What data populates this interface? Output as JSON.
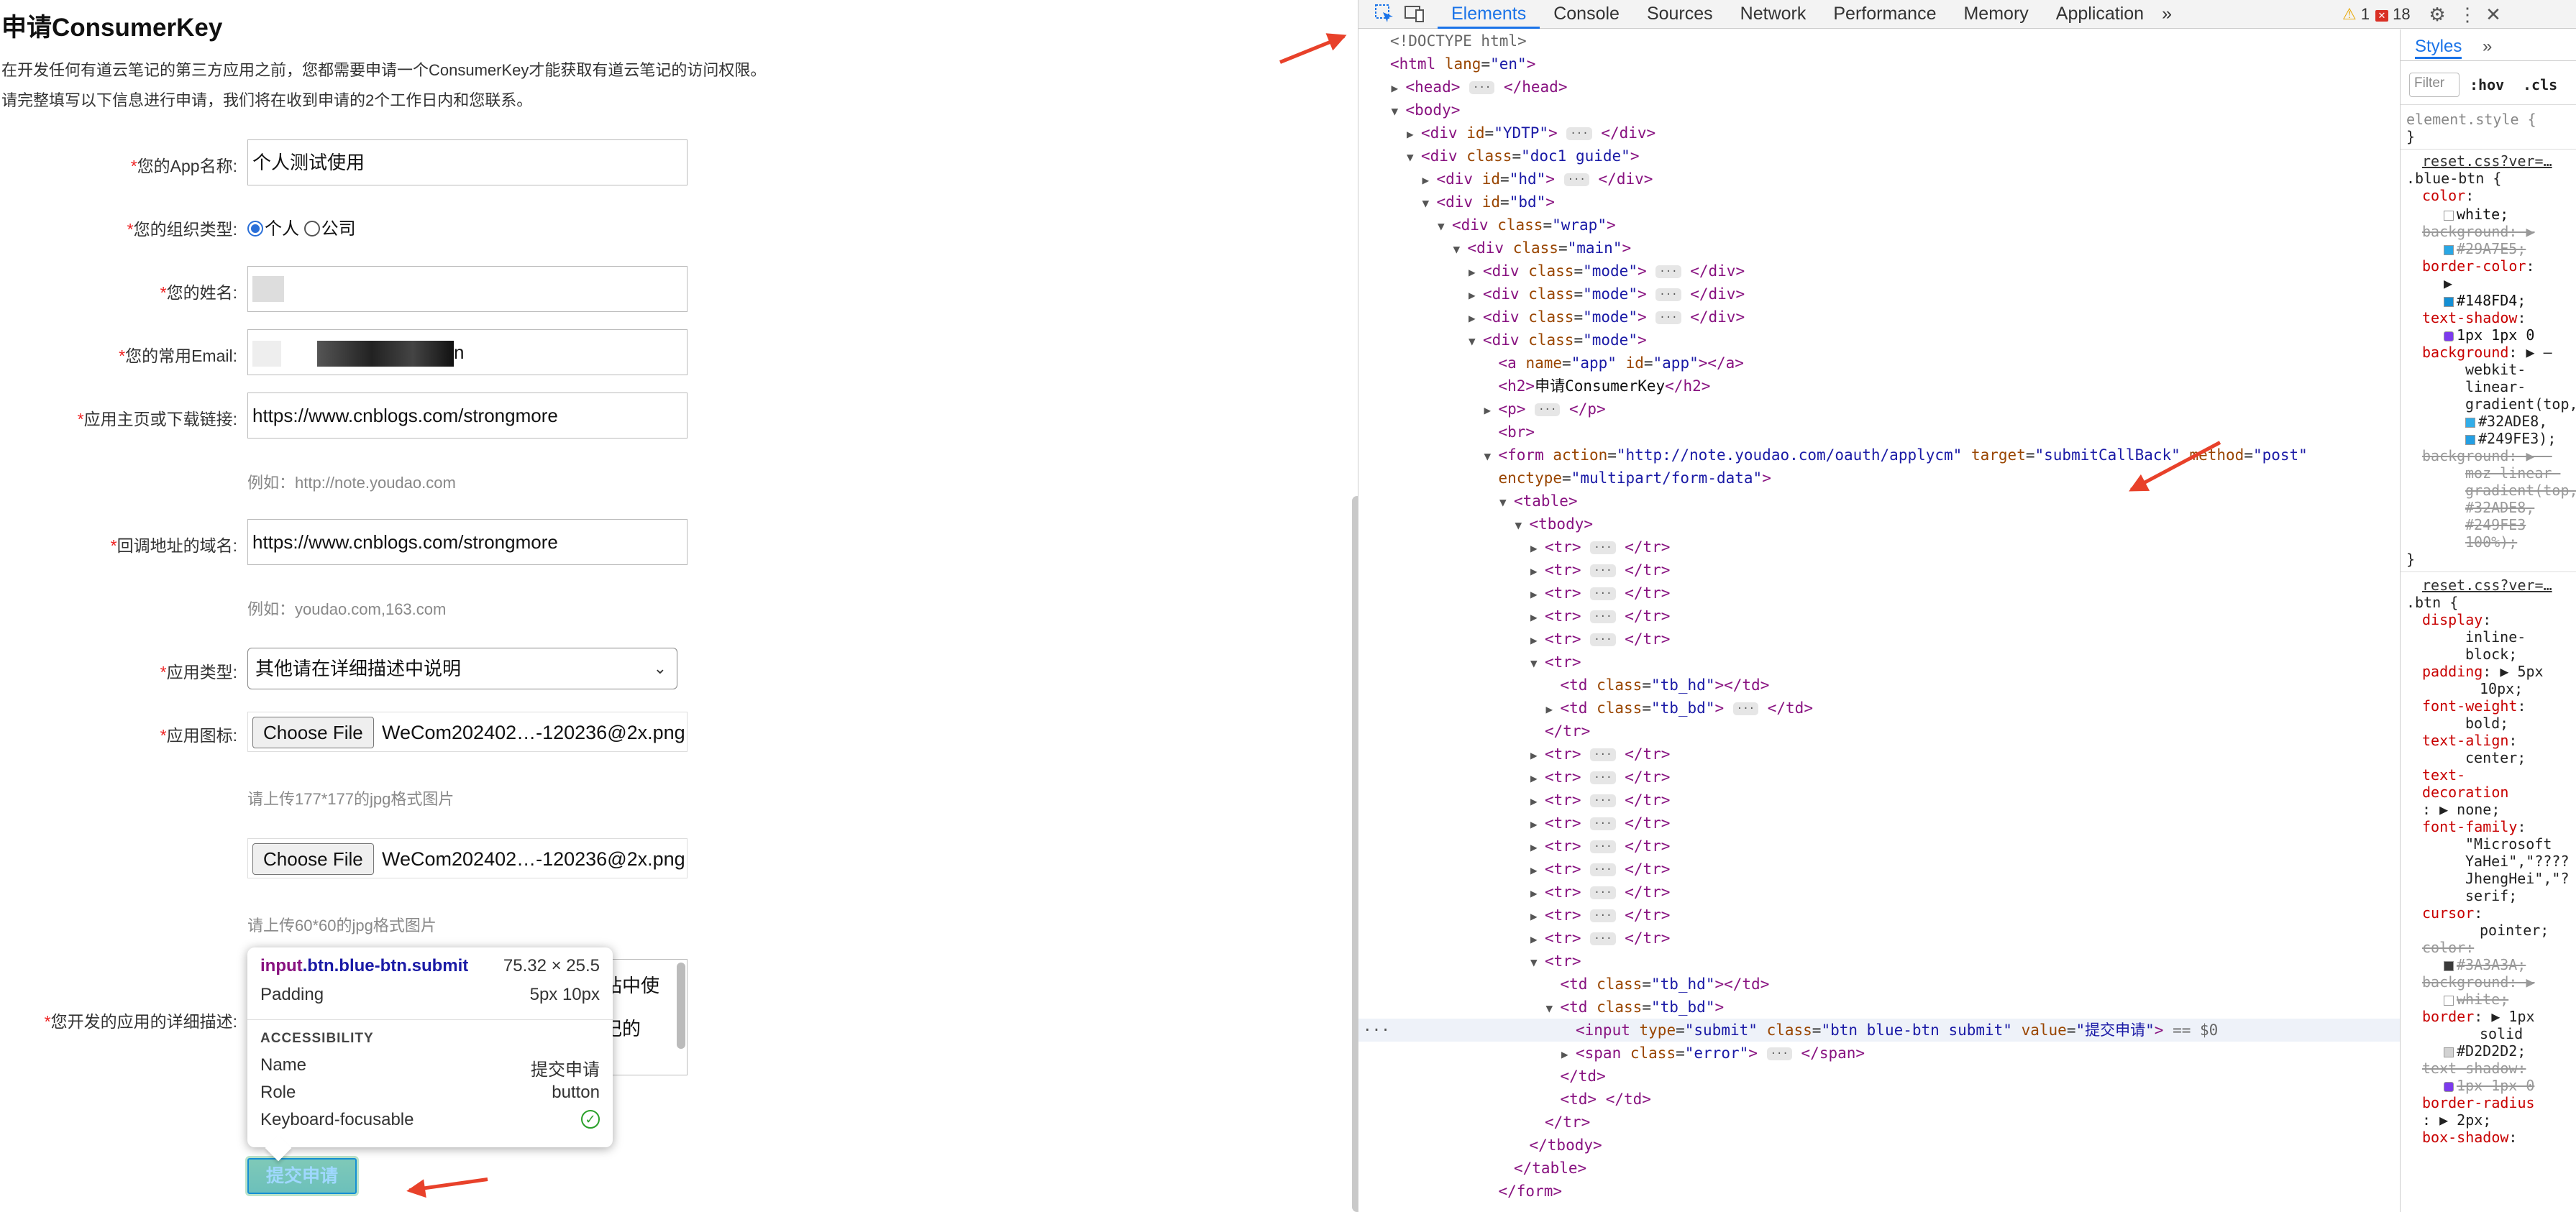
{
  "page": {
    "title": "申请ConsumerKey",
    "intro1": "在开发任何有道云笔记的第三方应用之前，您都需要申请一个ConsumerKey才能获取有道云笔记的访问权限。",
    "intro2": "请完整填写以下信息进行申请，我们将在收到申请的2个工作日内和您联系。"
  },
  "form": {
    "app_name_label": "您的App名称:",
    "app_name_value": "个人测试使用",
    "org_type_label": "您的组织类型:",
    "org_personal": "个人",
    "org_company": "公司",
    "name_label": "您的姓名:",
    "email_label": "您的常用Email:",
    "email_tail": "n",
    "homepage_label": "应用主页或下载链接:",
    "homepage_value": "https://www.cnblogs.com/strongmore",
    "homepage_hint": "例如：http://note.youdao.com",
    "callback_label": "回调地址的域名:",
    "callback_value": "https://www.cnblogs.com/strongmore",
    "callback_hint": "例如：youdao.com,163.com",
    "apptype_label": "应用类型:",
    "apptype_value": "其他请在详细描述中说明",
    "icon_label": "应用图标:",
    "choose_file": "Choose File",
    "file1": "WeCom202402…-120236@2x.png",
    "hint1": "请上传177*177的jpg格式图片",
    "file2": "WeCom202402…-120236@2x.png",
    "hint2": "请上传60*60的jpg格式图片",
    "desc_label": "您开发的应用的详细描述:",
    "desc_line1": "站中使",
    "desc_line2": "记的",
    "submit": "提交申请"
  },
  "tooltip": {
    "selector_tag": "input",
    "selector_class": ".btn.blue-btn.submit",
    "size": "75.32 × 25.5",
    "padding_label": "Padding",
    "padding_value": "5px 10px",
    "accessibility": "ACCESSIBILITY",
    "name_label": "Name",
    "name_value": "提交申请",
    "role_label": "Role",
    "role_value": "button",
    "kbd_label": "Keyboard-focusable"
  },
  "devtools": {
    "tabs": [
      "Elements",
      "Console",
      "Sources",
      "Network",
      "Performance",
      "Memory",
      "Application"
    ],
    "more_tabs": "»",
    "warnings": "1",
    "errors": "18",
    "styles_tab": "Styles",
    "styles_more": "»",
    "filter_placeholder": "Filter",
    "hov": ":hov",
    "cls": ".cls",
    "element_style": "element.style {",
    "close_brace": "}",
    "src1": "reset.css?ver=…",
    "sel1": ".blue-btn {",
    "src2": "reset.css?ver=…",
    "sel2": ".btn {",
    "dom_lines": [
      {
        "indent": 0,
        "html": "<span class='cm'>&lt;!DOCTYPE html&gt;</span>"
      },
      {
        "indent": 0,
        "html": "<span class='t'>&lt;html</span> <span class='an'>lang</span>=<span class='av'>\"en\"</span><span class='t'>&gt;</span>"
      },
      {
        "indent": 1,
        "tw": "▶",
        "html": "<span class='t'>&lt;head&gt;</span> <span class='ell'>···</span> <span class='t'>&lt;/head&gt;</span>"
      },
      {
        "indent": 1,
        "tw": "▼",
        "html": "<span class='t'>&lt;body&gt;</span>"
      },
      {
        "indent": 2,
        "tw": "▶",
        "html": "<span class='t'>&lt;div</span> <span class='an'>id</span>=<span class='av'>\"YDTP\"</span><span class='t'>&gt;</span> <span class='ell'>···</span> <span class='t'>&lt;/div&gt;</span>"
      },
      {
        "indent": 2,
        "tw": "▼",
        "html": "<span class='t'>&lt;div</span> <span class='an'>class</span>=<span class='av'>\"doc1 guide\"</span><span class='t'>&gt;</span>"
      },
      {
        "indent": 3,
        "tw": "▶",
        "html": "<span class='t'>&lt;div</span> <span class='an'>id</span>=<span class='av'>\"hd\"</span><span class='t'>&gt;</span> <span class='ell'>···</span> <span class='t'>&lt;/div&gt;</span>"
      },
      {
        "indent": 3,
        "tw": "▼",
        "html": "<span class='t'>&lt;div</span> <span class='an'>id</span>=<span class='av'>\"bd\"</span><span class='t'>&gt;</span>"
      },
      {
        "indent": 4,
        "tw": "▼",
        "html": "<span class='t'>&lt;div</span> <span class='an'>class</span>=<span class='av'>\"wrap\"</span><span class='t'>&gt;</span>"
      },
      {
        "indent": 5,
        "tw": "▼",
        "html": "<span class='t'>&lt;div</span> <span class='an'>class</span>=<span class='av'>\"main\"</span><span class='t'>&gt;</span>"
      },
      {
        "indent": 6,
        "tw": "▶",
        "html": "<span class='t'>&lt;div</span> <span class='an'>class</span>=<span class='av'>\"mode\"</span><span class='t'>&gt;</span> <span class='ell'>···</span> <span class='t'>&lt;/div&gt;</span>"
      },
      {
        "indent": 6,
        "tw": "▶",
        "html": "<span class='t'>&lt;div</span> <span class='an'>class</span>=<span class='av'>\"mode\"</span><span class='t'>&gt;</span> <span class='ell'>···</span> <span class='t'>&lt;/div&gt;</span>"
      },
      {
        "indent": 6,
        "tw": "▶",
        "html": "<span class='t'>&lt;div</span> <span class='an'>class</span>=<span class='av'>\"mode\"</span><span class='t'>&gt;</span> <span class='ell'>···</span> <span class='t'>&lt;/div&gt;</span>"
      },
      {
        "indent": 6,
        "tw": "▼",
        "html": "<span class='t'>&lt;div</span> <span class='an'>class</span>=<span class='av'>\"mode\"</span><span class='t'>&gt;</span>"
      },
      {
        "indent": 7,
        "html": "<span class='t'>&lt;a</span> <span class='an'>name</span>=<span class='av'>\"app\"</span> <span class='an'>id</span>=<span class='av'>\"app\"</span><span class='t'>&gt;&lt;/a&gt;</span>"
      },
      {
        "indent": 7,
        "html": "<span class='t'>&lt;h2&gt;</span><span class='tx'>申请ConsumerKey</span><span class='t'>&lt;/h2&gt;</span>"
      },
      {
        "indent": 7,
        "tw": "▶",
        "html": "<span class='t'>&lt;p&gt;</span> <span class='ell'>···</span> <span class='t'>&lt;/p&gt;</span>"
      },
      {
        "indent": 7,
        "html": "<span class='t'>&lt;br&gt;</span>"
      },
      {
        "indent": 7,
        "tw": "▼",
        "html": "<span class='t'>&lt;form</span> <span class='an'>action</span>=<span class='av'>\"http://note.youdao.com/oauth/applycm\"</span> <span class='an'>target</span>=<span class='av'>\"submitCallBack\"</span> <span class='an'>method</span>=<span class='av'>\"post\"</span>"
      },
      {
        "indent": 7,
        "html": "<span class='an'>enctype</span>=<span class='av'>\"multipart/form-data\"</span><span class='t'>&gt;</span>"
      },
      {
        "indent": 8,
        "tw": "▼",
        "html": "<span class='t'>&lt;table&gt;</span>"
      },
      {
        "indent": 9,
        "tw": "▼",
        "html": "<span class='t'>&lt;tbody&gt;</span>"
      },
      {
        "indent": 10,
        "tw": "▶",
        "html": "<span class='t'>&lt;tr&gt;</span> <span class='ell'>···</span> <span class='t'>&lt;/tr&gt;</span>"
      },
      {
        "indent": 10,
        "tw": "▶",
        "html": "<span class='t'>&lt;tr&gt;</span> <span class='ell'>···</span> <span class='t'>&lt;/tr&gt;</span>"
      },
      {
        "indent": 10,
        "tw": "▶",
        "html": "<span class='t'>&lt;tr&gt;</span> <span class='ell'>···</span> <span class='t'>&lt;/tr&gt;</span>"
      },
      {
        "indent": 10,
        "tw": "▶",
        "html": "<span class='t'>&lt;tr&gt;</span> <span class='ell'>···</span> <span class='t'>&lt;/tr&gt;</span>"
      },
      {
        "indent": 10,
        "tw": "▶",
        "html": "<span class='t'>&lt;tr&gt;</span> <span class='ell'>···</span> <span class='t'>&lt;/tr&gt;</span>"
      },
      {
        "indent": 10,
        "tw": "▼",
        "html": "<span class='t'>&lt;tr&gt;</span>"
      },
      {
        "indent": 11,
        "html": "<span class='t'>&lt;td</span> <span class='an'>class</span>=<span class='av'>\"tb_hd\"</span><span class='t'>&gt;&lt;/td&gt;</span>"
      },
      {
        "indent": 11,
        "tw": "▶",
        "html": "<span class='t'>&lt;td</span> <span class='an'>class</span>=<span class='av'>\"tb_bd\"</span><span class='t'>&gt;</span> <span class='ell'>···</span> <span class='t'>&lt;/td&gt;</span>"
      },
      {
        "indent": 10,
        "html": "<span class='t'>&lt;/tr&gt;</span>"
      },
      {
        "indent": 10,
        "tw": "▶",
        "html": "<span class='t'>&lt;tr&gt;</span> <span class='ell'>···</span> <span class='t'>&lt;/tr&gt;</span>"
      },
      {
        "indent": 10,
        "tw": "▶",
        "html": "<span class='t'>&lt;tr&gt;</span> <span class='ell'>···</span> <span class='t'>&lt;/tr&gt;</span>"
      },
      {
        "indent": 10,
        "tw": "▶",
        "html": "<span class='t'>&lt;tr&gt;</span> <span class='ell'>···</span> <span class='t'>&lt;/tr&gt;</span>"
      },
      {
        "indent": 10,
        "tw": "▶",
        "html": "<span class='t'>&lt;tr&gt;</span> <span class='ell'>···</span> <span class='t'>&lt;/tr&gt;</span>"
      },
      {
        "indent": 10,
        "tw": "▶",
        "html": "<span class='t'>&lt;tr&gt;</span> <span class='ell'>···</span> <span class='t'>&lt;/tr&gt;</span>"
      },
      {
        "indent": 10,
        "tw": "▶",
        "html": "<span class='t'>&lt;tr&gt;</span> <span class='ell'>···</span> <span class='t'>&lt;/tr&gt;</span>"
      },
      {
        "indent": 10,
        "tw": "▶",
        "html": "<span class='t'>&lt;tr&gt;</span> <span class='ell'>···</span> <span class='t'>&lt;/tr&gt;</span>"
      },
      {
        "indent": 10,
        "tw": "▶",
        "html": "<span class='t'>&lt;tr&gt;</span> <span class='ell'>···</span> <span class='t'>&lt;/tr&gt;</span>"
      },
      {
        "indent": 10,
        "tw": "▶",
        "html": "<span class='t'>&lt;tr&gt;</span> <span class='ell'>···</span> <span class='t'>&lt;/tr&gt;</span>"
      },
      {
        "indent": 10,
        "tw": "▼",
        "html": "<span class='t'>&lt;tr&gt;</span>"
      },
      {
        "indent": 11,
        "html": "<span class='t'>&lt;td</span> <span class='an'>class</span>=<span class='av'>\"tb_hd\"</span><span class='t'>&gt;&lt;/td&gt;</span>"
      },
      {
        "indent": 11,
        "tw": "▼",
        "html": "<span class='t'>&lt;td</span> <span class='an'>class</span>=<span class='av'>\"tb_bd\"</span><span class='t'>&gt;</span>"
      },
      {
        "indent": 12,
        "hl": true,
        "html": "<span class='t'>&lt;input</span> <span class='an'>type</span>=<span class='av'>\"submit\"</span> <span class='an'>class</span>=<span class='av'>\"btn blue-btn submit\"</span> <span class='an'>value</span>=<span class='av'>\"提交申请\"</span><span class='t'>&gt;</span> <span class='cm'>== $0</span>"
      },
      {
        "indent": 12,
        "tw": "▶",
        "html": "<span class='t'>&lt;span</span> <span class='an'>class</span>=<span class='av'>\"error\"</span><span class='t'>&gt;</span> <span class='ell'>···</span> <span class='t'>&lt;/span&gt;</span>"
      },
      {
        "indent": 11,
        "html": "<span class='t'>&lt;/td&gt;</span>"
      },
      {
        "indent": 11,
        "html": "<span class='t'>&lt;td&gt;</span> <span class='t'>&lt;/td&gt;</span>"
      },
      {
        "indent": 10,
        "html": "<span class='t'>&lt;/tr&gt;</span>"
      },
      {
        "indent": 9,
        "html": "<span class='t'>&lt;/tbody&gt;</span>"
      },
      {
        "indent": 8,
        "html": "<span class='t'>&lt;/table&gt;</span>"
      },
      {
        "indent": 7,
        "html": "<span class='t'>&lt;/form&gt;</span>"
      }
    ]
  },
  "colors": {
    "accent": "#1a73e8",
    "required": "#e22222",
    "arrow": "#e8412a",
    "blue_btn_border": "#148FD4"
  }
}
